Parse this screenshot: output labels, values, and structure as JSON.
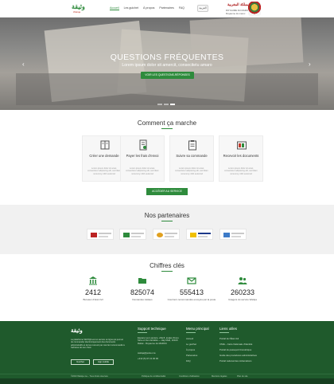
{
  "header": {
    "nav": [
      "Accueil",
      "Les guichet",
      "À propos",
      "Partenaires",
      "FAQ"
    ],
    "active_index": 0,
    "lang_button": "العربية",
    "logo_text": "وثيقة",
    "logo_sub": "Watiqa",
    "gov_arabic": "المملكة المغربية",
    "gov_line1": "ROYAUME DU MAROC",
    "gov_line2": "Royaume du maroc"
  },
  "hero": {
    "title": "QUESTIONS FRÉQUENTES",
    "subtitle": "Lorem ipsum dolor sit amercit, consecitetu amaro",
    "button": "VOIR LES QUESTIONS-RÉPONSES",
    "prev_arrow": "‹",
    "next_arrow": "›"
  },
  "how": {
    "title": "Comment ça marche",
    "steps": [
      {
        "title": "Créer une demande",
        "desc": "Lorem ipsum dolor sit amet, consectetur adipiscing elit, sed diam nonummy nibh euismod"
      },
      {
        "title": "Payer les frais d'envoi",
        "desc": "Lorem ipsum dolor sit amet, consectetur adipiscing elit, sed diam nonummy nibh euismod"
      },
      {
        "title": "Suivre sa commande",
        "desc": "Lorem ipsum dolor sit amet, consectetur adipiscing elit, sed diam nonummy nibh euismod"
      },
      {
        "title": "Recevoir les documents",
        "desc": "Lorem ipsum dolor sit amet, consectetur adipiscing elit, sed diam nonummy nibh euismod"
      }
    ],
    "button": "ACCÉDER AU SERVICE"
  },
  "partners": {
    "title": "Nos partenaires"
  },
  "stats": {
    "title": "Chiffres clés",
    "items": [
      {
        "value": "2412",
        "label": "Bureaux d'état civil"
      },
      {
        "value": "825074",
        "label": "Demandes traitées"
      },
      {
        "value": "555413",
        "label": "Courriers recommandés envoyés par la poste"
      },
      {
        "value": "260233",
        "label": "Usagers du service Watiqa"
      }
    ]
  },
  "footer": {
    "logo": "وثيقة",
    "about": "La plateforme WATIQA est un service en ligne qui permet de commander électroniquement des documents administratifs et de les recevoir par courrier recommandé à l'adresse de son choix.",
    "btn1": "Guichet",
    "btn2": "App mobile",
    "support_title": "Support technique",
    "support_items": [
      "Espace Les Lauriers, villa 8, angles Ibnou Sina et Oum Errabia — Hay Riad, 10100 Rabat - Royaume du MAROC",
      "watiqa@poste.ma",
      "+212 (5) 37 21 00 00"
    ],
    "menu_title": "Menu principal",
    "menu_items": [
      "Accueil",
      "Le guichet",
      "À propos",
      "Partenaires",
      "FAQ"
    ],
    "links_title": "Liens utiles",
    "links_items": [
      "Portail de l'État civil",
      "CNIE – Carte Nationale d'Identité",
      "Portail du passeport biométrique",
      "Guide des procédures administratives",
      "Portail national des réclamations"
    ],
    "copyright": "©2023 Watiqa.ma – Tous droits réservés",
    "legal": [
      "Politique de confidentialité",
      "Conditions d'utilisation",
      "Mentions légales",
      "Plan du site"
    ]
  },
  "colors": {
    "accent": "#2e8b3c",
    "footer_bg": "#1f5a2c"
  },
  "icons": [
    "book-icon",
    "receipt-icon",
    "clipboard-icon",
    "archive-icon",
    "building-icon",
    "folder-icon",
    "envelope-icon",
    "users-icon"
  ]
}
